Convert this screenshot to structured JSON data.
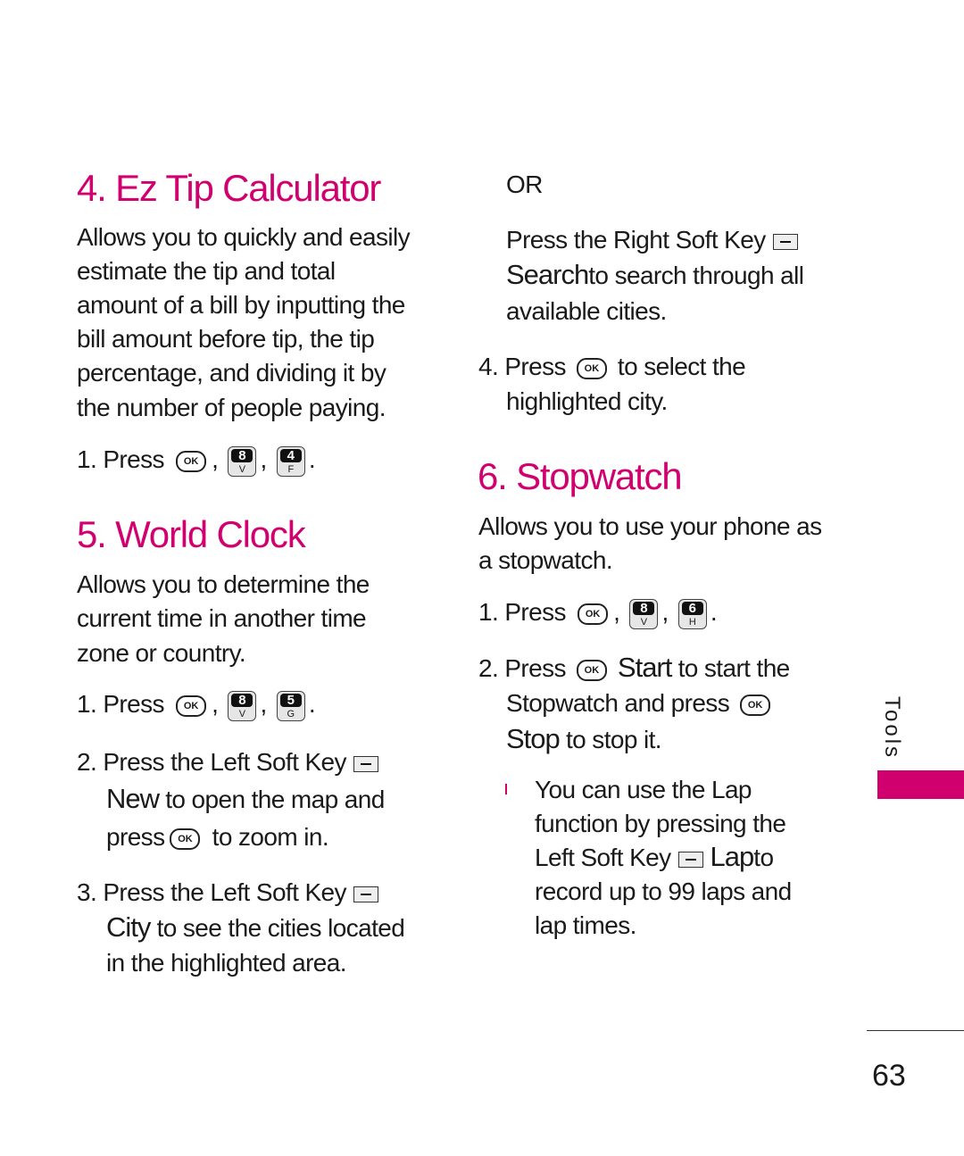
{
  "keys": {
    "ok": "OK",
    "k8": {
      "num": "8",
      "letter": "V"
    },
    "k4": {
      "num": "4",
      "letter": "F"
    },
    "k5": {
      "num": "5",
      "letter": "G"
    },
    "k6": {
      "num": "6",
      "letter": "H"
    }
  },
  "tip": {
    "title": "4. Ez Tip Calculator",
    "para": [
      "Allows you to quickly and easily",
      "estimate the tip and total",
      "amount of a bill by inputting the",
      "bill amount before tip, the tip",
      "percentage, and dividing it by",
      "the number of people paying."
    ],
    "step1": "1. Press"
  },
  "world": {
    "title": "5. World Clock",
    "para": [
      "Allows you to determine the",
      "current time in another time",
      "zone or country."
    ],
    "step1": "1. Press",
    "step2": {
      "a": "2. Press the Left Soft Key",
      "b_key": "New",
      "b": "to open the map and",
      "c1": "press",
      "c2": "to zoom in."
    },
    "step3": {
      "a": "3. Press the Left Soft Key",
      "b_key": "City",
      "b": "to see the cities located",
      "c": "in the highlighted area."
    }
  },
  "right": {
    "or": "OR",
    "rsk_a": "Press the Right Soft Key",
    "rsk_key": "Search",
    "rsk_b": "to search through all",
    "rsk_c": "available cities.",
    "step4a": "4. Press",
    "step4b": "to select the",
    "step4c": "highlighted city."
  },
  "stopwatch": {
    "title": "6. Stopwatch",
    "para": [
      "Allows you to use your phone as",
      "a stopwatch."
    ],
    "step1": "1. Press",
    "step2": {
      "a": "2. Press",
      "start": "Start",
      "a2": "to start the",
      "b": "Stopwatch and press",
      "stop": "Stop",
      "c": "to stop it."
    },
    "note": {
      "l1": "You can use the Lap",
      "l2": "function by pressing the",
      "l3": "Left Soft Key",
      "lap": "Lap",
      "l3b": "to",
      "l4": "record up to 99 laps and",
      "l5": "lap times."
    }
  },
  "side_tab": "Tools",
  "page_number": "63",
  "accent_color": "#d1006f"
}
